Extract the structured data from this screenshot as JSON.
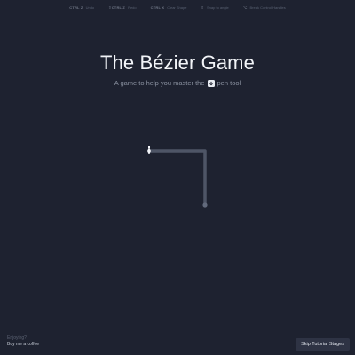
{
  "shortcuts": [
    {
      "key": "CTRL Z",
      "label": "Undo",
      "icon": "undo-key-icon"
    },
    {
      "key": "⇧CTRL Z",
      "label": "Redo",
      "icon": "redo-key-icon"
    },
    {
      "key": "CTRL X",
      "label": "Clear Shape",
      "icon": "clear-key-icon"
    },
    {
      "key": "⇧",
      "label": "Snap to angle",
      "icon": "shift-key-icon"
    },
    {
      "key": "⌥",
      "label": "Break Control Handles",
      "icon": "alt-key-icon"
    }
  ],
  "title": "The Bézier Game",
  "subtitle": {
    "before": "A game to help you master the",
    "after": "pen tool",
    "icon": "pen-tool-icon"
  },
  "footer": {
    "question": "Enjoying?",
    "coffee_link": "Buy me a coffee"
  },
  "skip_button": "Skip Tutorial Stages",
  "colors": {
    "background": "#1e2230",
    "path": "#4e5566",
    "text": "#f2f4f8",
    "muted": "#8a91a0"
  }
}
